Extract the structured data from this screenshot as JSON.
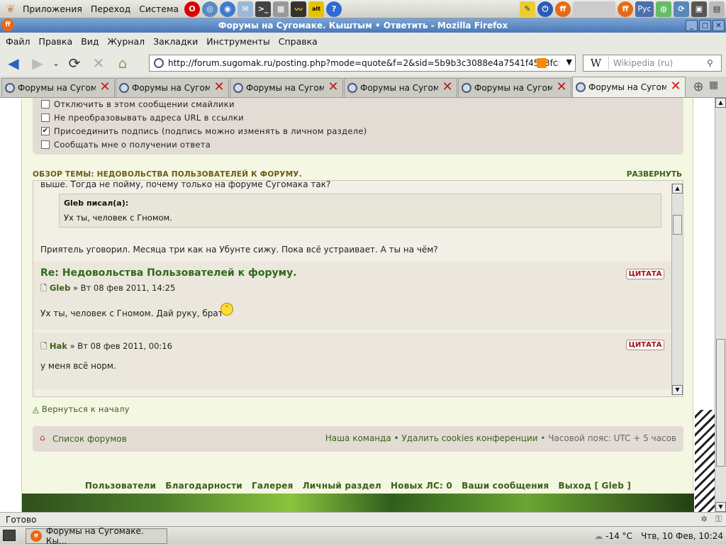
{
  "panel": {
    "menu": [
      "Приложения",
      "Переход",
      "Система"
    ],
    "lang": "Рус"
  },
  "window": {
    "title": "Форумы на Сугомаке. Кыштым • Ответить - Mozilla Firefox"
  },
  "menubar": [
    "Файл",
    "Правка",
    "Вид",
    "Журнал",
    "Закладки",
    "Инструменты",
    "Справка"
  ],
  "nav": {
    "url": "http://forum.sugomak.ru/posting.php?mode=quote&f=2&sid=5b9b3c3088e4a7541f45b3fc",
    "search_placeholder": "Wikipedia (ru)",
    "search_engine": "W"
  },
  "tabs": [
    {
      "label": "Форумы на Сугом..."
    },
    {
      "label": "Форумы на Сугом..."
    },
    {
      "label": "Форумы на Сугом..."
    },
    {
      "label": "Форумы на Сугом..."
    },
    {
      "label": "Форумы на Сугом..."
    },
    {
      "label": "Форумы на Сугом..."
    }
  ],
  "options": [
    {
      "label": "Отключить в этом сообщении смайлики",
      "checked": false
    },
    {
      "label": "Не преобразовывать адреса URL в ссылки",
      "checked": false
    },
    {
      "label": "Присоединить подпись (подпись можно изменять в личном разделе)",
      "checked": true
    },
    {
      "label": "Сообщать мне о получении ответа",
      "checked": false
    }
  ],
  "review": {
    "heading": "ОБЗОР ТЕМЫ: НЕДОВОЛЬСТВА ПОЛЬЗОВАТЕЛЕЙ К ФОРУМУ.",
    "expand": "РАЗВЕРНУТЬ",
    "partial_text": "выше. Тогда не пойму, почему только на форуме Сугомака так?",
    "quote_author": "Gleb писал(а):",
    "quote_text": "Ух ты, человек с Гномом.",
    "text1": "Приятель уговорил. Месяца три как на Убунте сижу. Пока всё устраивает. А ты на чём?",
    "post2": {
      "title": "Re: Недовольства Пользователей к форуму.",
      "author": "Gleb",
      "date": "» Вт 08 фев 2011, 14:25",
      "text": "Ух ты, человек с Гномом. Дай руку, брат"
    },
    "post3": {
      "author": "Hak",
      "date": "» Вт 08 фев 2011, 00:16",
      "text": "у меня всё норм."
    },
    "quote_btn": "ЦИТАТА"
  },
  "back_to_top": "Вернуться к началу",
  "footer": {
    "forum_list": "Список форумов",
    "team": "Наша команда",
    "delete_cookies": "Удалить cookies конференции",
    "timezone": "Часовой пояс: UTC + 5 часов",
    "links": [
      "Пользователи",
      "Благодарности",
      "Галерея",
      "Личный раздел",
      "Новых ЛС: 0",
      "Ваши сообщения",
      "Выход [ Gleb ]"
    ]
  },
  "status": "Готово",
  "taskbar": {
    "task": "Форумы на Сугомаке. Кы...",
    "temp": "-14 °C",
    "clock": "Чтв, 10 Фев, 10:24"
  }
}
